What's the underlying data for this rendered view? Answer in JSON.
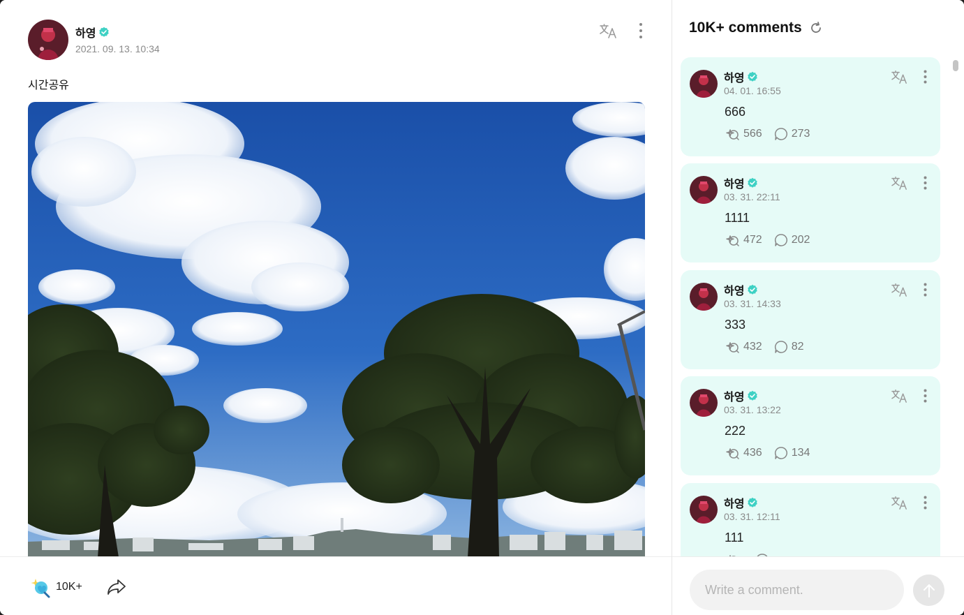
{
  "post": {
    "author": "하영",
    "date": "2021. 09. 13. 10:34",
    "text": "시간공유",
    "like_count": "10K+",
    "icons": {
      "translate": "translate-icon",
      "more": "more-vertical-icon",
      "verified": "verified-badge-icon",
      "like": "sparkle-heart-icon",
      "share": "share-arrow-icon"
    }
  },
  "comments": {
    "title": "10K+ comments",
    "refresh_icon": "refresh-icon",
    "input_placeholder": "Write a comment.",
    "send_icon": "send-arrow-icon",
    "items": [
      {
        "author": "하영",
        "date": "04. 01. 16:55",
        "text": "666",
        "likes": "566",
        "replies": "273"
      },
      {
        "author": "하영",
        "date": "03. 31. 22:11",
        "text": "1111",
        "likes": "472",
        "replies": "202"
      },
      {
        "author": "하영",
        "date": "03. 31. 14:33",
        "text": "333",
        "likes": "432",
        "replies": "82"
      },
      {
        "author": "하영",
        "date": "03. 31. 13:22",
        "text": "222",
        "likes": "436",
        "replies": "134"
      },
      {
        "author": "하영",
        "date": "03. 31. 12:11",
        "text": "111",
        "likes": "",
        "replies": ""
      }
    ]
  },
  "colors": {
    "accent": "#3ed1c4",
    "card_bg": "#e6fbf7",
    "muted_text": "#8a8a8a"
  }
}
